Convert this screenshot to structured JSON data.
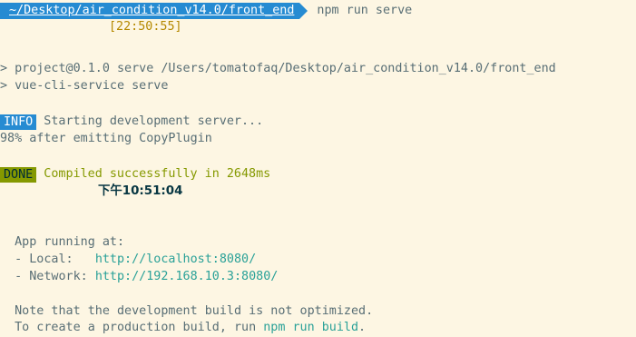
{
  "prompt": {
    "path": "~/Desktop/air_condition_v14.0/front_end",
    "command": "npm run serve",
    "time": "[22:50:55]"
  },
  "output": {
    "line_project": "> project@0.1.0 serve /Users/tomatofaq/Desktop/air_condition_v14.0/front_end",
    "line_vue_cli": "> vue-cli-service serve",
    "info_badge": "INFO",
    "info_text": " Starting development server...",
    "progress_text": "98% after emitting CopyPlugin",
    "done_badge": "DONE",
    "done_text": " Compiled successfully in 2648ms",
    "done_time": "下午10:51:04",
    "app_running": "  App running at:",
    "local_label": "  - Local:   ",
    "local_url": "http://localhost:8080/",
    "network_label": "  - Network: ",
    "network_url": "http://192.168.10.3:8080/",
    "note_line": "  Note that the development build is not optimized.",
    "prod_prefix": "  To create a production build, run ",
    "prod_cmd": "npm run build",
    "prod_suffix": "."
  },
  "colors": {
    "background": "#fdf6e3",
    "text": "#586e75",
    "prompt_bg": "#268bd2",
    "time": "#b58900",
    "info_bg": "#268bd2",
    "done_bg": "#859900",
    "url": "#2aa198"
  }
}
